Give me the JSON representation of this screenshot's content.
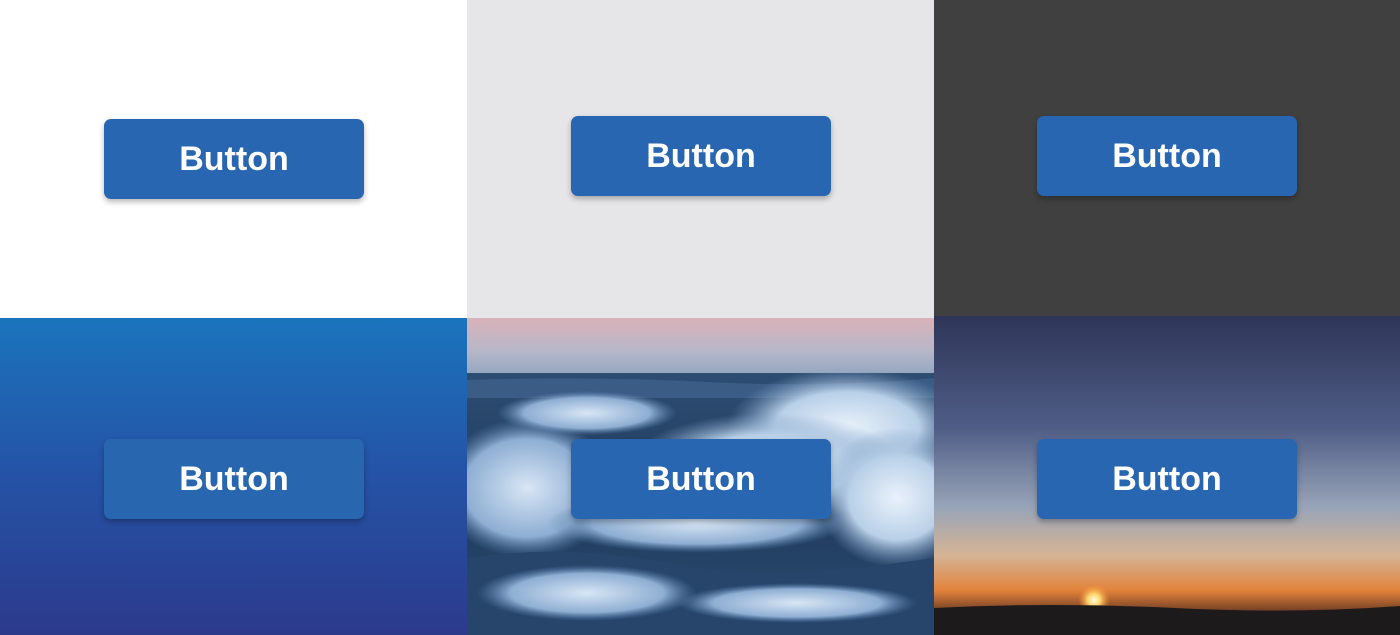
{
  "colors": {
    "button": "#2866b1",
    "button_on_blue": "#2867b0",
    "white_panel": "#ffffff",
    "light_gray_panel": "#e6e6e8",
    "dark_gray_panel": "#404040",
    "blue_gradient_top": "#1b74bd",
    "blue_gradient_bottom": "#2c3a8c"
  },
  "panels": [
    {
      "background": "plain-white",
      "button": {
        "label": "Button"
      }
    },
    {
      "background": "plain-light-gray",
      "button": {
        "label": "Button"
      }
    },
    {
      "background": "plain-dark-gray",
      "button": {
        "label": "Button"
      }
    },
    {
      "background": "blue-gradient",
      "button": {
        "label": "Button"
      }
    },
    {
      "background": "ocean-waves-photo",
      "button": {
        "label": "Button"
      }
    },
    {
      "background": "sunset-horizon-photo",
      "button": {
        "label": "Button"
      }
    }
  ]
}
